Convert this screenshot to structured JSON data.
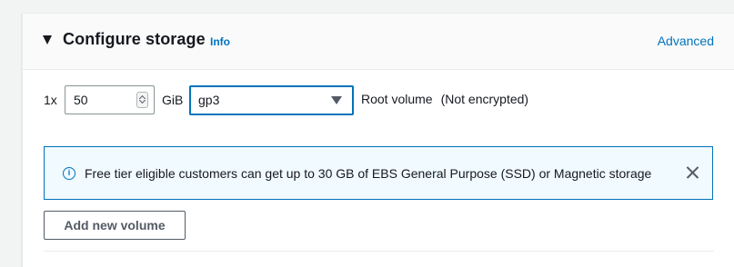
{
  "section": {
    "title": "Configure storage",
    "info_link": "Info",
    "advanced_link": "Advanced"
  },
  "volume": {
    "count_label": "1x",
    "size_value": "50",
    "size_unit": "GiB",
    "volume_type": "gp3",
    "root_label": "Root volume",
    "encryption_label": "(Not encrypted)"
  },
  "alert": {
    "icon": "info-icon",
    "text": "Free tier eligible customers can get up to 30 GB of EBS General Purpose (SSD) or Magnetic storage",
    "close_icon": "close-icon"
  },
  "actions": {
    "add_volume_label": "Add new volume"
  },
  "colors": {
    "link": "#0073bb",
    "alert_background": "#f1faff",
    "alert_border": "#0073bb",
    "page_background": "#f2f3f3"
  }
}
